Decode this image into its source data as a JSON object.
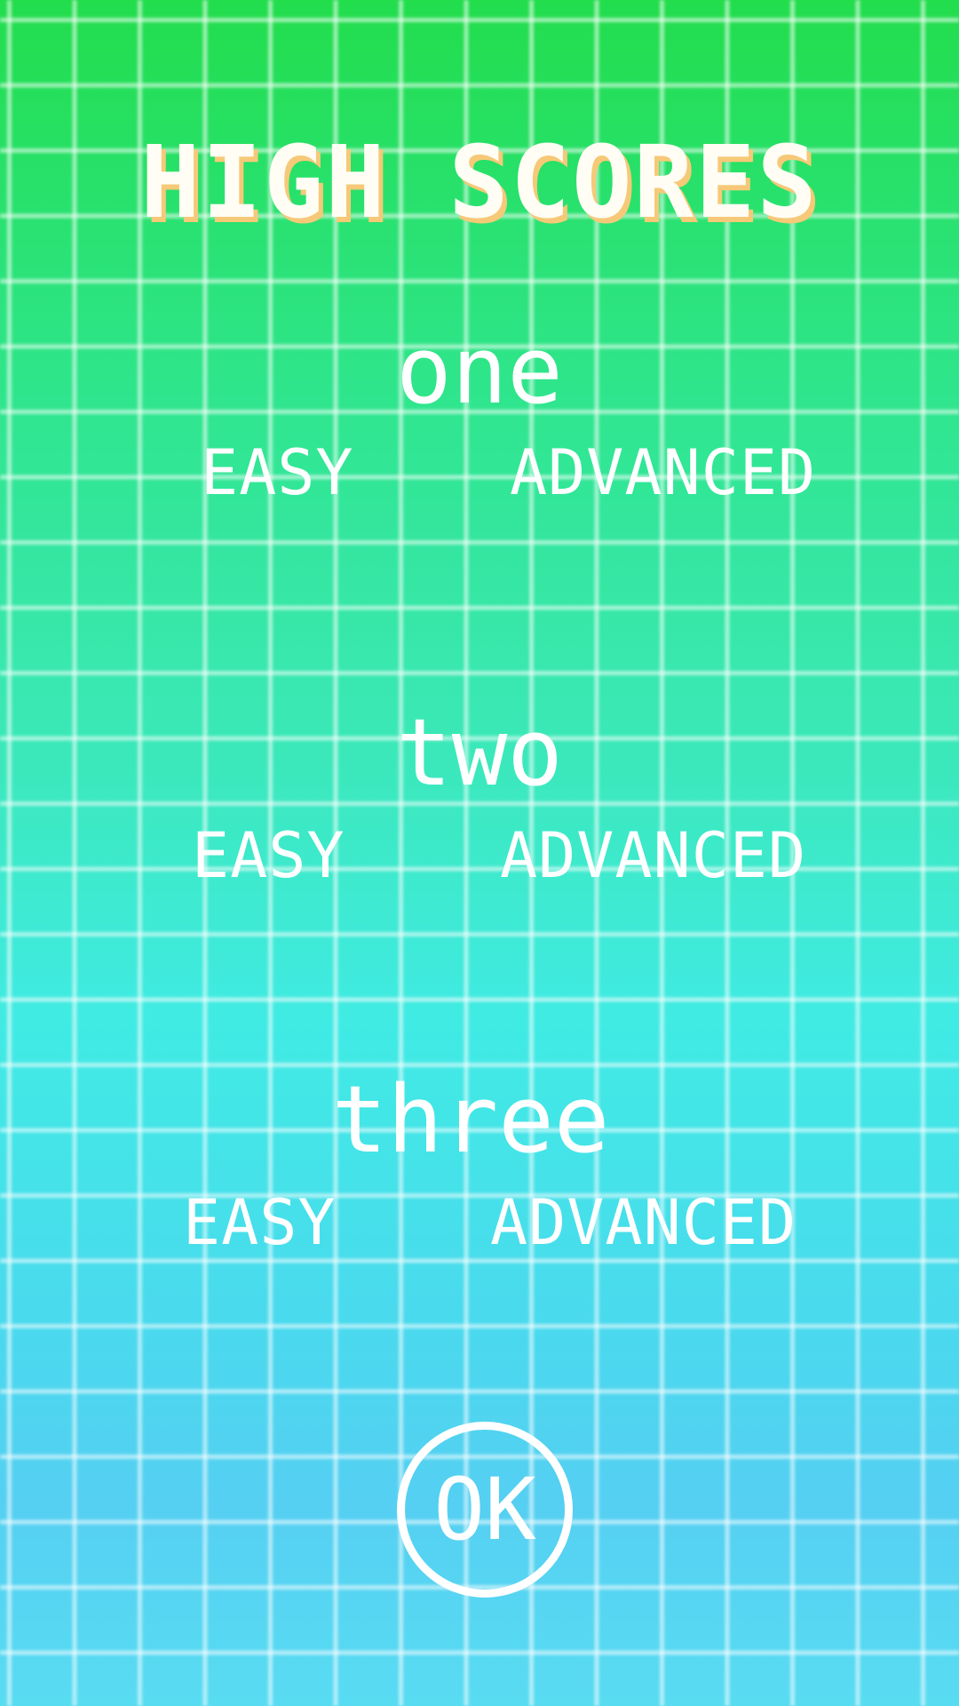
{
  "title": "HIGH SCORES",
  "levels": [
    {
      "name": "one",
      "easy_label": "EASY",
      "advanced_label": "ADVANCED"
    },
    {
      "name": "two",
      "easy_label": "EASY",
      "advanced_label": "ADVANCED"
    },
    {
      "name": "three",
      "easy_label": "EASY",
      "advanced_label": "ADVANCED"
    }
  ],
  "ok_button": {
    "label": "OK"
  },
  "colors": {
    "background_top": "#22dd4c",
    "background_bottom": "#58dcf2",
    "grid_line": "#ffffff",
    "title_shadow": "#f6c978",
    "text": "#ffffff"
  }
}
